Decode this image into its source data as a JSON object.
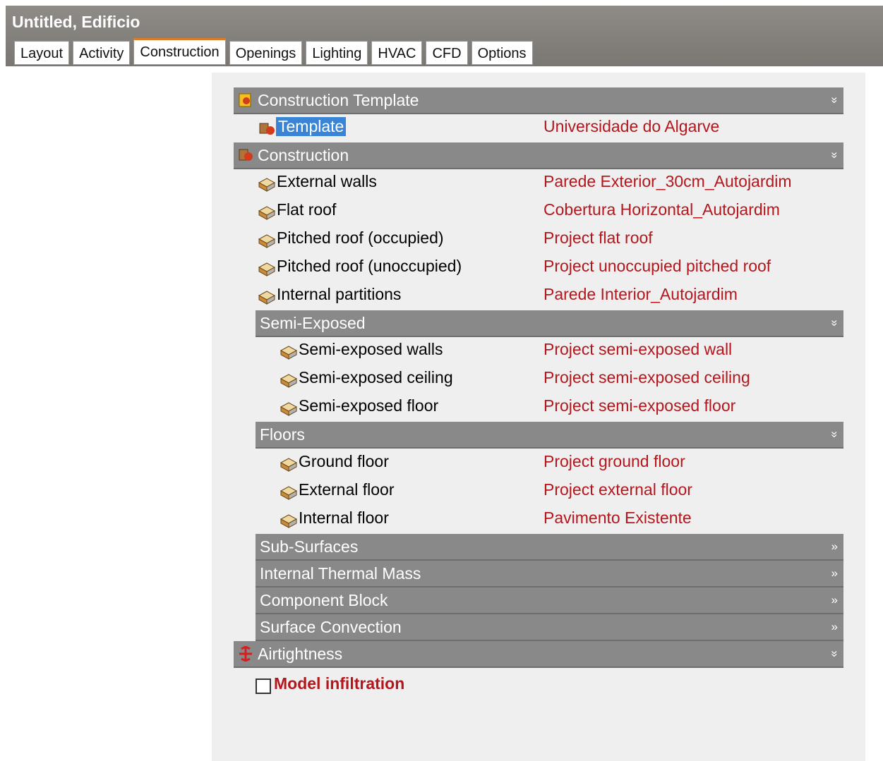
{
  "window": {
    "title": "Untitled, Edificio"
  },
  "tabs": [
    {
      "label": "Layout"
    },
    {
      "label": "Activity"
    },
    {
      "label": "Construction",
      "active": true
    },
    {
      "label": "Openings"
    },
    {
      "label": "Lighting"
    },
    {
      "label": "HVAC"
    },
    {
      "label": "CFD"
    },
    {
      "label": "Options"
    }
  ],
  "sections": {
    "construction_template": {
      "title": "Construction Template",
      "chevron": "»"
    },
    "template": {
      "label": "Template",
      "value": "Universidade do Algarve"
    },
    "construction": {
      "title": "Construction",
      "chevron": "»"
    },
    "construction_items": [
      {
        "label": "External walls",
        "value": "Parede Exterior_30cm_Autojardim"
      },
      {
        "label": "Flat roof",
        "value": "Cobertura Horizontal_Autojardim"
      },
      {
        "label": "Pitched roof (occupied)",
        "value": "Project flat roof"
      },
      {
        "label": "Pitched roof (unoccupied)",
        "value": "Project unoccupied pitched roof"
      },
      {
        "label": "Internal partitions",
        "value": "Parede Interior_Autojardim"
      }
    ],
    "semi_exposed": {
      "title": "Semi-Exposed",
      "chevron": "»"
    },
    "semi_items": [
      {
        "label": "Semi-exposed walls",
        "value": "Project semi-exposed wall"
      },
      {
        "label": "Semi-exposed ceiling",
        "value": "Project semi-exposed ceiling"
      },
      {
        "label": "Semi-exposed floor",
        "value": "Project semi-exposed floor"
      }
    ],
    "floors": {
      "title": "Floors",
      "chevron": "»"
    },
    "floor_items": [
      {
        "label": "Ground floor",
        "value": "Project ground floor"
      },
      {
        "label": "External floor",
        "value": "Project external floor"
      },
      {
        "label": "Internal floor",
        "value": "Pavimento Existente"
      }
    ],
    "collapsed": [
      {
        "title": "Sub-Surfaces",
        "chevron": "»"
      },
      {
        "title": "Internal Thermal Mass",
        "chevron": "»"
      },
      {
        "title": "Component Block",
        "chevron": "»"
      },
      {
        "title": "Surface Convection",
        "chevron": "»"
      }
    ],
    "airtightness": {
      "title": "Airtightness",
      "chevron": "»"
    },
    "model_infiltration": {
      "label": "Model infiltration",
      "checked": false
    }
  },
  "colors": {
    "header": "#898989",
    "value_red": "#b4161c",
    "selection": "#3a84d6",
    "active_tab_accent": "#e07a22"
  }
}
